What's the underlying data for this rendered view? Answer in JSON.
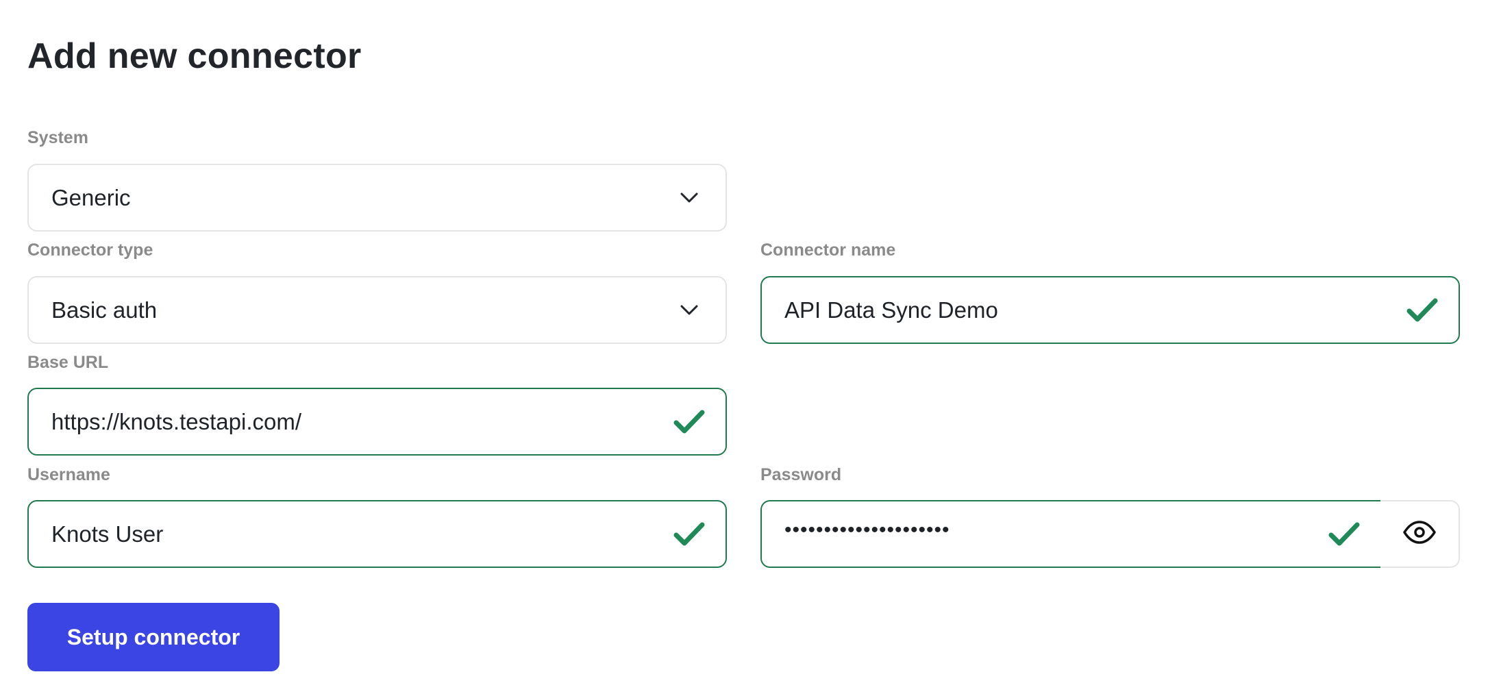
{
  "page": {
    "title": "Add new connector"
  },
  "form": {
    "system": {
      "label": "System",
      "value": "Generic",
      "icon": "chevron-down-icon"
    },
    "connector_type": {
      "label": "Connector type",
      "value": "Basic auth",
      "icon": "chevron-down-icon"
    },
    "connector_name": {
      "label": "Connector name",
      "value": "API Data Sync Demo",
      "valid": true,
      "icon": "check-icon"
    },
    "base_url": {
      "label": "Base URL",
      "value": "https://knots.testapi.com/",
      "valid": true,
      "icon": "check-icon"
    },
    "username": {
      "label": "Username",
      "value": "Knots User",
      "valid": true,
      "icon": "check-icon"
    },
    "password": {
      "label": "Password",
      "masked_value": "•••••••••••••••••••••",
      "valid": true,
      "icon": "check-icon",
      "toggle_icon": "eye-icon"
    },
    "submit_label": "Setup connector"
  },
  "colors": {
    "accent": "#3b45e4",
    "valid_border": "#1f7a4e",
    "check": "#1f8a57",
    "neutral_border": "#e4e4e4",
    "label": "#8a8a8a",
    "title": "#22252a"
  }
}
